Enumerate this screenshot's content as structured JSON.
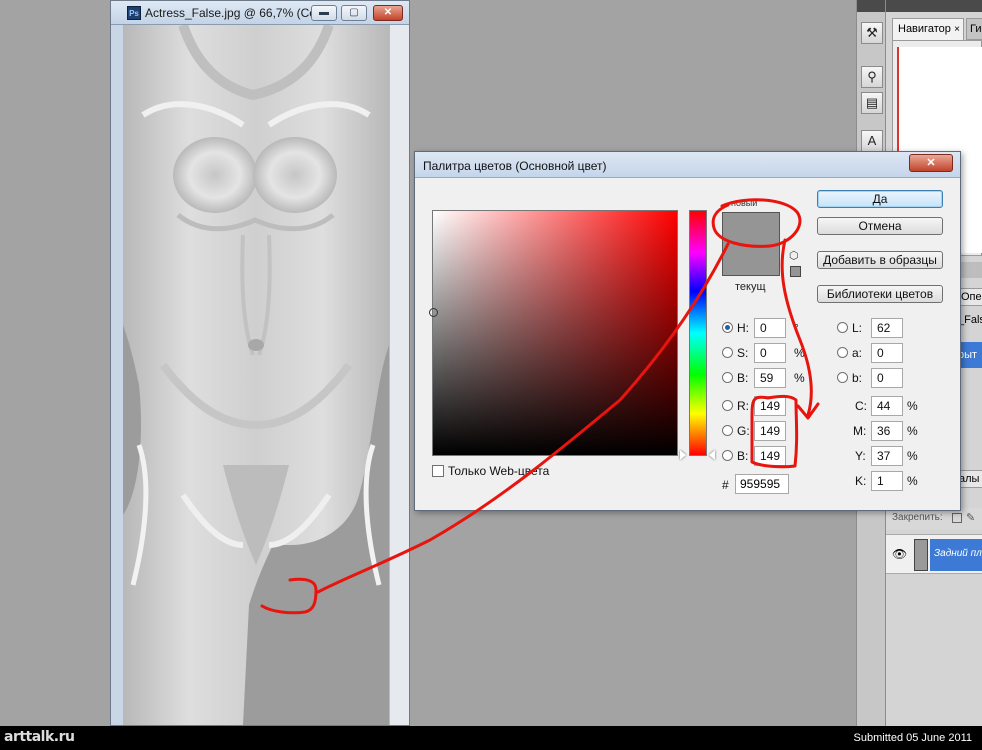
{
  "document_window": {
    "app_icon": "Ps",
    "title": "Actress_False.jpg @ 66,7% (Се...",
    "min_glyph": "▬",
    "max_glyph": "▢",
    "close_glyph": "✕"
  },
  "tools_strip": {
    "icons": [
      "tools-icon",
      "stamp-icon",
      "layers-stack-icon",
      "text-icon"
    ],
    "glyphs": [
      "⚒",
      "⚲",
      "▤",
      "A"
    ]
  },
  "panels": {
    "navigator_tab": "Навигатор",
    "navigator_close": "×",
    "histogram_tab": "Гис",
    "ops_tab": "Опе",
    "ops_item": "_False",
    "ops_selected": "рыт",
    "layers_tab": "алы",
    "lock_label": "Закрепить:",
    "layer_eye": "👁",
    "layer_name": "Задний пла"
  },
  "picker": {
    "title": "Палитра цветов (Основной цвет)",
    "close_glyph": "✕",
    "label_new": "новый",
    "label_current": "текущ",
    "buttons": {
      "ok": "Да",
      "cancel": "Отмена",
      "add_swatch": "Добавить в образцы",
      "color_libraries": "Библиотеки цветов"
    },
    "hsb": [
      {
        "label": "H:",
        "value": "0",
        "unit": "°",
        "checked": true
      },
      {
        "label": "S:",
        "value": "0",
        "unit": "%",
        "checked": false
      },
      {
        "label": "B:",
        "value": "59",
        "unit": "%",
        "checked": false
      }
    ],
    "rgb": [
      {
        "label": "R:",
        "value": "149"
      },
      {
        "label": "G:",
        "value": "149"
      },
      {
        "label": "B:",
        "value": "149"
      }
    ],
    "lab": [
      {
        "label": "L:",
        "value": "62"
      },
      {
        "label": "a:",
        "value": "0"
      },
      {
        "label": "b:",
        "value": "0"
      }
    ],
    "cmyk": [
      {
        "label": "C:",
        "value": "44",
        "unit": "%"
      },
      {
        "label": "M:",
        "value": "36",
        "unit": "%"
      },
      {
        "label": "Y:",
        "value": "37",
        "unit": "%"
      },
      {
        "label": "K:",
        "value": "1",
        "unit": "%"
      }
    ],
    "websafe_label": "Только Web-цвета",
    "hex_label": "#",
    "hex_value": "959595",
    "new_color": "#959595",
    "current_color": "#959595"
  },
  "colors": {
    "annotation_red": "#e8140e",
    "selection_blue": "#3d7ad6"
  },
  "footer": {
    "logo": "arttalk.ru",
    "submitted": "Submitted 05 June 2011"
  }
}
